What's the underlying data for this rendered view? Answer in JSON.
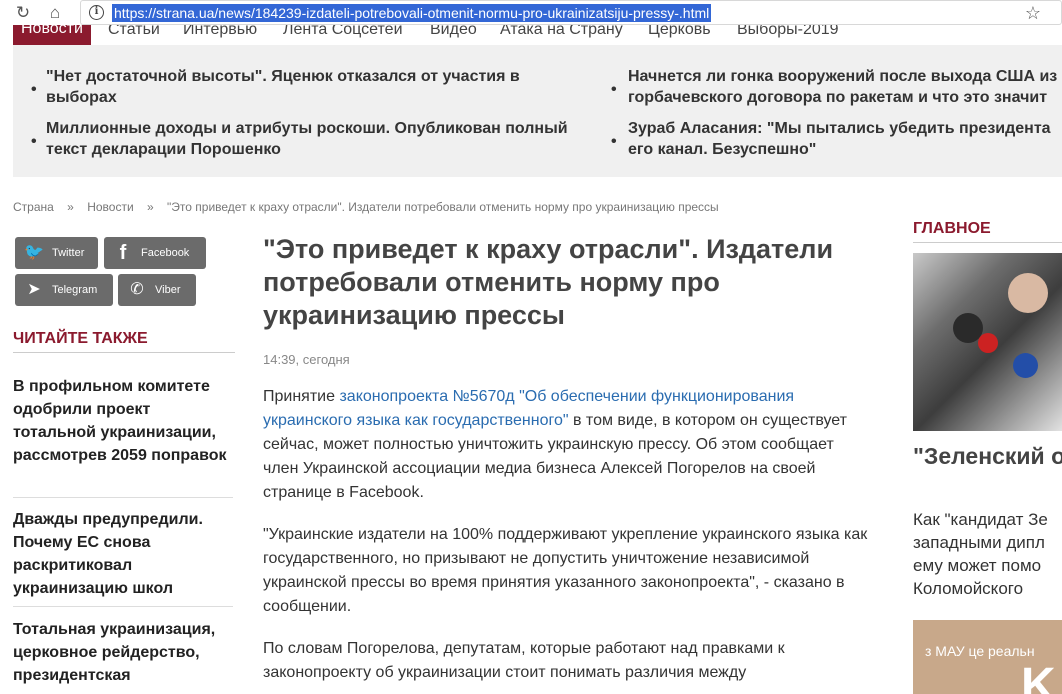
{
  "browser": {
    "url": "https://strana.ua/news/184239-izdateli-potrebovali-otmenit-normu-pro-ukrainizatsiju-pressy-.html",
    "back_icon": "reload-icon",
    "home_icon": "home-icon"
  },
  "nav": {
    "items": [
      "Новости",
      "Статьи",
      "Интервью",
      "Лента Соцсетей",
      "Видео",
      "Атака на Страну",
      "Церковь",
      "Выборы-2019"
    ],
    "active_color": "#8b1a2e"
  },
  "top_news": [
    "\"Нет достаточной высоты\". Яценюк отказался от участия в выборах",
    "Миллионные доходы и атрибуты роскоши. Опубликован полный текст декларации Порошенко",
    "Начнется ли гонка вооружений после выхода США из горбачевского договора по ракетам и что это значит",
    "Зураб Аласания: \"Мы пытались убедить президента его канал. Безуспешно\""
  ],
  "breadcrumb": {
    "items": [
      "Страна",
      "»",
      "Новости",
      "»",
      "\"Это приведет к краху отрасли\". Издатели потребовали отменить норму про украинизацию прессы"
    ]
  },
  "social": {
    "twitter": "Twitter",
    "facebook": "Facebook",
    "telegram": "Telegram",
    "viber": "Viber"
  },
  "read_also": {
    "title": "ЧИТАЙТЕ ТАКЖЕ",
    "items": [
      "В профильном комитете одобрили проект тотальной украинизации, рассмотрев 2059 поправок",
      "Дважды предупредили. Почему ЕС снова раскритиковал украинизацию школ",
      "Тотальная украинизация, церковное рейдерство, президентская"
    ]
  },
  "article": {
    "headline": "\"Это приведет к краху отрасли\". Издатели потребовали отменить норму про украинизацию прессы",
    "time": "14:39, сегодня",
    "p1_before": "Принятие ",
    "p1_link": "законопроекта №5670д \"Об обеспечении функционирования украинского языка как государственного\"",
    "p1_after": " в том виде, в котором он существует сейчас, может полностью уничтожить украинскую прессу. Об этом сообщает член Украинской ассоциации медиа бизнеса Алексей Погорелов на своей странице в Facebook.",
    "p2": "\"Украинские издатели на 100% поддерживают укрепление украинского языка как государственного, но призывают не допустить уничтожение независимой украинской прессы во время принятия указанного законопроекта\", - сказано в сообщении.",
    "p3": "По словам Погорелова, депутатам, которые работают над правками к законопроекту об украинизации стоит понимать различия между"
  },
  "main_block": {
    "title": "ГЛАВНОЕ",
    "headline": "\"Зеленский о послов\"",
    "text": "Как \"кандидат Зе западными дипл ему может помо Коломойского",
    "ad_text": "з МАУ це реальн",
    "ad_letter": "K"
  }
}
